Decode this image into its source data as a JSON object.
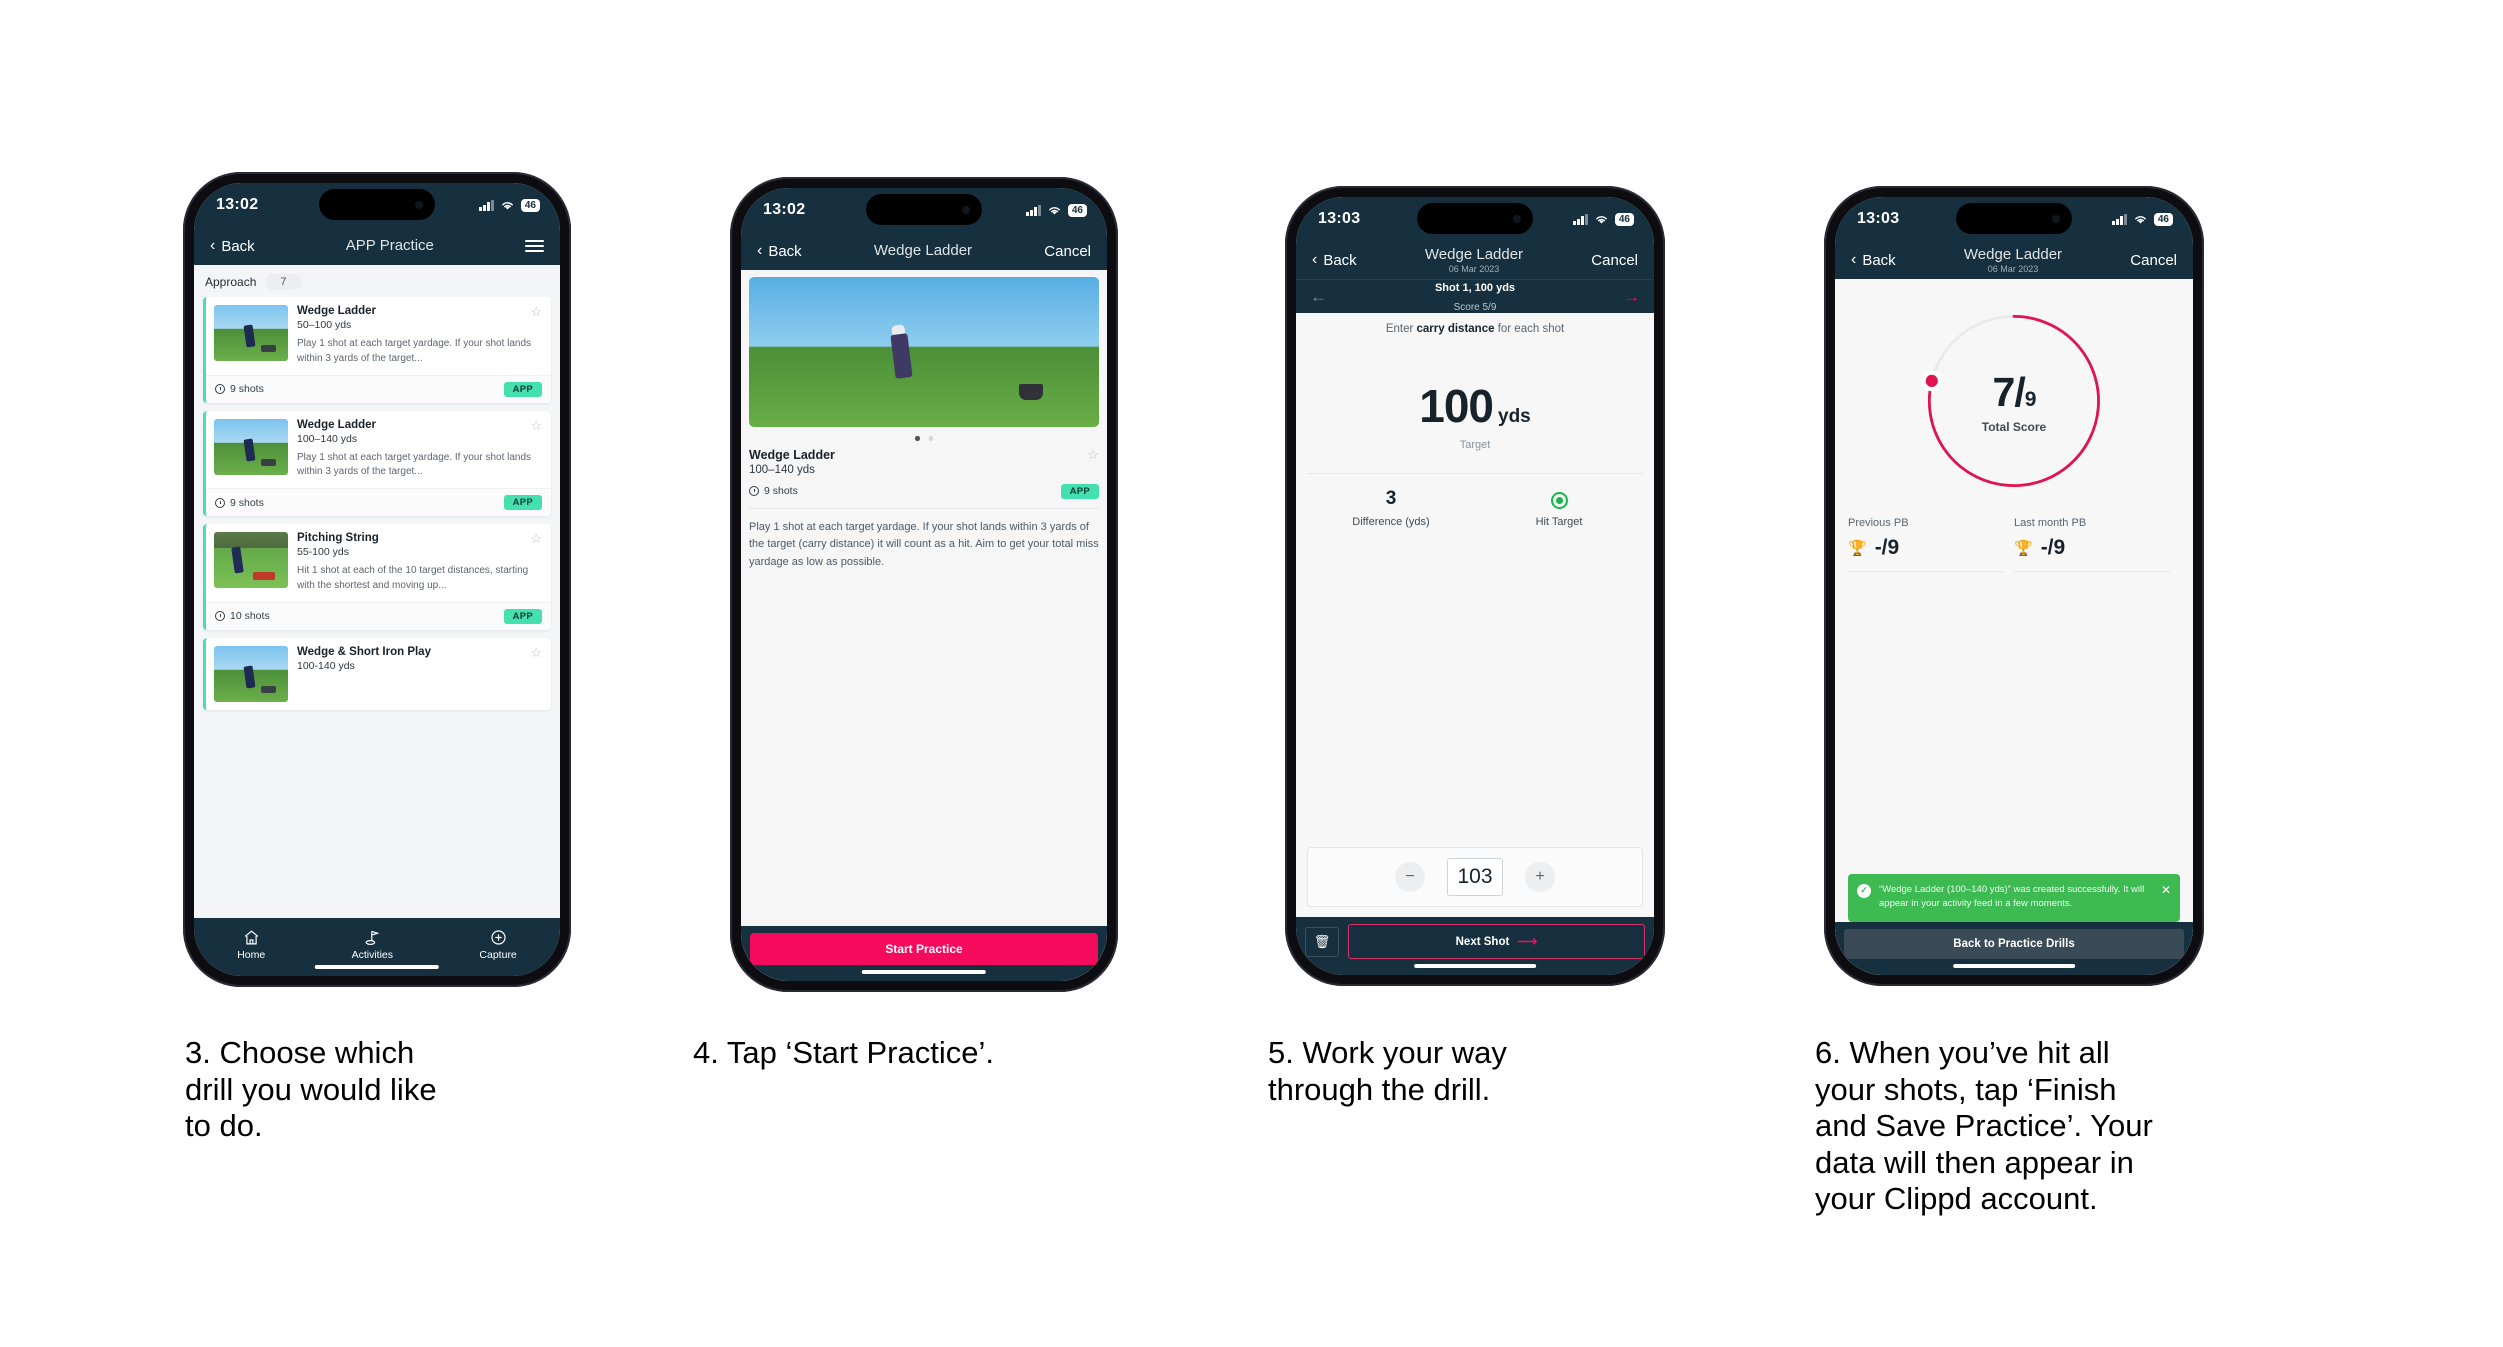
{
  "phones": [
    {
      "status": {
        "time": "13:02",
        "battery": "46"
      },
      "nav": {
        "back": "Back",
        "title": "APP Practice",
        "menu_icon": "hamburger-icon"
      },
      "category": {
        "name": "Approach",
        "count": "7"
      },
      "cards": [
        {
          "title": "Wedge Ladder",
          "yards": "50–100 yds",
          "desc": "Play 1 shot at each target yardage. If your shot lands within 3 yards of the target...",
          "shots": "9 shots",
          "tag": "APP"
        },
        {
          "title": "Wedge Ladder",
          "yards": "100–140 yds",
          "desc": "Play 1 shot at each target yardage. If your shot lands within 3 yards of the target...",
          "shots": "9 shots",
          "tag": "APP"
        },
        {
          "title": "Pitching String",
          "yards": "55-100 yds",
          "desc": "Hit 1 shot at each of the 10 target distances, starting with the shortest and moving up...",
          "shots": "10 shots",
          "tag": "APP"
        },
        {
          "title": "Wedge & Short Iron Play",
          "yards": "100-140 yds",
          "desc": "",
          "shots": "",
          "tag": ""
        }
      ],
      "tabs": [
        {
          "label": "Home",
          "icon": "home-icon"
        },
        {
          "label": "Activities",
          "icon": "golf-flag-icon"
        },
        {
          "label": "Capture",
          "icon": "plus-circle-icon"
        }
      ]
    },
    {
      "status": {
        "time": "13:02",
        "battery": "46"
      },
      "nav": {
        "back": "Back",
        "title": "Wedge Ladder",
        "cancel": "Cancel"
      },
      "detail": {
        "title": "Wedge Ladder",
        "yards": "100–140 yds",
        "shots": "9 shots",
        "tag": "APP",
        "desc": "Play 1 shot at each target yardage. If your shot lands within 3 yards of the target (carry distance) it will count as a hit. Aim to get your total miss yardage as low as possible."
      },
      "cta": "Start Practice"
    },
    {
      "status": {
        "time": "13:03",
        "battery": "46"
      },
      "nav": {
        "back": "Back",
        "title": "Wedge Ladder",
        "subtitle": "06 Mar 2023",
        "cancel": "Cancel"
      },
      "shotbar": {
        "title": "Shot 1, 100 yds",
        "score": "Score 5/9"
      },
      "prompt_pre": "Enter ",
      "prompt_bold": "carry distance",
      "prompt_post": " for each shot",
      "target": {
        "value": "100",
        "unit": "yds",
        "label": "Target"
      },
      "stats": [
        {
          "value": "3",
          "label": "Difference (yds)"
        },
        {
          "value": "",
          "label": "Hit Target",
          "icon": "target-hit-icon"
        }
      ],
      "stepper": {
        "minus": "−",
        "value": "103",
        "plus": "+"
      },
      "footer": {
        "delete_icon": "trash-icon",
        "next": "Next Shot"
      }
    },
    {
      "status": {
        "time": "13:03",
        "battery": "46"
      },
      "nav": {
        "back": "Back",
        "title": "Wedge Ladder",
        "subtitle": "06 Mar 2023",
        "cancel": "Cancel"
      },
      "ring": {
        "score": "7",
        "slash": "/",
        "total": "9",
        "label": "Total Score",
        "percent": 78
      },
      "pbs": [
        {
          "label": "Previous PB",
          "value": "-/9",
          "icon": "trophy-icon"
        },
        {
          "label": "Last month PB",
          "value": "-/9",
          "icon": "trophy-icon"
        }
      ],
      "toast": {
        "text": "“Wedge Ladder (100–140 yds)” was created successfully. It will appear in your activity feed in a few moments.",
        "close_icon": "close-icon"
      },
      "footer": {
        "button": "Back to Practice Drills"
      }
    }
  ],
  "captions": [
    "3. Choose which\ndrill you would like\nto do.",
    "4. Tap ‘Start Practice’.",
    "5. Work your way\nthrough the drill.",
    "6. When you’ve hit all\nyour shots, tap ‘Finish\nand Save Practice’. Your\ndata will then appear in\nyour Clippd account."
  ],
  "colors": {
    "dark": "#16303f",
    "pink": "#f50a5c",
    "teal": "#44e0b0",
    "green": "#3dbb52",
    "ring": "#e0144f"
  }
}
